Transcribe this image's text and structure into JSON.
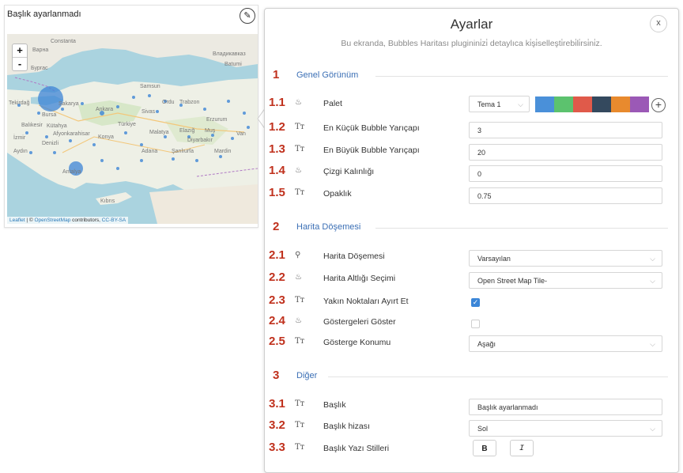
{
  "map": {
    "title": "Başlık ayarlanmadı",
    "zoom_in": "+",
    "zoom_out": "-",
    "edit_icon": "pencil-icon",
    "attribution": {
      "leaflet": "Leaflet",
      "sep": " | © ",
      "osm": "OpenStreetMap",
      "contrib": " contributors, ",
      "license": "CC-BY-SA"
    },
    "place_labels": [
      "Constanta",
      "Varna",
      "Burgas",
      "Tekirdağ",
      "Bursa",
      "Balıkesir",
      "İzmir",
      "Aydın",
      "Denizli",
      "Kütahya",
      "Afyonkarahisar",
      "Sakarya",
      "Ankara",
      "Konya",
      "Türkiye",
      "Samsun",
      "Ordu",
      "Trabzon",
      "Sivas",
      "Erzurum",
      "Elazığ",
      "Muş",
      "Van",
      "Malatya",
      "Diyarbakır",
      "Adana",
      "Şanlıurfa",
      "Mardin",
      "Antalya",
      "Kıbrıs",
      "Batumi",
      "Владикавказ"
    ]
  },
  "panel": {
    "title": "Ayarlar",
    "subtitle": "Bu ekranda, Bubbles Haritası pluginini̇zi̇ detaylıca ki̇şi̇selleşti̇rebi̇li̇rsi̇ni̇z.",
    "close": "x"
  },
  "sections": [
    {
      "num": "1",
      "label": "Genel Görünüm"
    },
    {
      "num": "2",
      "label": "Harita Döşemesi"
    },
    {
      "num": "3",
      "label": "Diğer"
    }
  ],
  "rows": {
    "r11": {
      "num": "1.1",
      "icon": "♨",
      "label": "Palet",
      "value": "Tema 1"
    },
    "r12": {
      "num": "1.2",
      "icon": "Tт",
      "label": "En Küçük Bubble Yarıçapı",
      "value": "3"
    },
    "r13": {
      "num": "1.3",
      "icon": "Tт",
      "label": "En Büyük Bubble Yarıçapı",
      "value": "20"
    },
    "r14": {
      "num": "1.4",
      "icon": "♨",
      "label": "Çizgi Kalınlığı",
      "value": "0"
    },
    "r15": {
      "num": "1.5",
      "icon": "Tт",
      "label": "Opaklık",
      "value": "0.75"
    },
    "r21": {
      "num": "2.1",
      "icon": "⚲",
      "label": "Harita Döşemesi",
      "value": "Varsayılan"
    },
    "r22": {
      "num": "2.2",
      "icon": "♨",
      "label": "Harita Altlığı Seçimi",
      "value": "Open Street Map Tile-"
    },
    "r23": {
      "num": "2.3",
      "icon": "Tт",
      "label": "Yakın Noktaları Ayırt Et",
      "checked": true
    },
    "r24": {
      "num": "2.4",
      "icon": "♨",
      "label": "Göstergeleri Göster",
      "checked": false
    },
    "r25": {
      "num": "2.5",
      "icon": "Tт",
      "label": "Gösterge Konumu",
      "value": "Aşağı"
    },
    "r31": {
      "num": "3.1",
      "icon": "Tт",
      "label": "Başlık",
      "value": "Başlık ayarlanmadı"
    },
    "r32": {
      "num": "3.2",
      "icon": "Tт",
      "label": "Başlık hizası",
      "value": "Sol"
    },
    "r33": {
      "num": "3.3",
      "icon": "Tт",
      "label": "Başlık Yazı Stilleri",
      "bold": "B",
      "italic": "I"
    }
  },
  "palette": [
    "#4a90d9",
    "#5cc26e",
    "#e05a4a",
    "#34495e",
    "#e88a2e",
    "#9b59b6"
  ],
  "palette_add": "+",
  "chevron": "⌵",
  "checkmark": "✓",
  "colors": {
    "accent": "#3b6fb5",
    "number_red": "#c0311d",
    "bubble": "#3c84d6"
  }
}
